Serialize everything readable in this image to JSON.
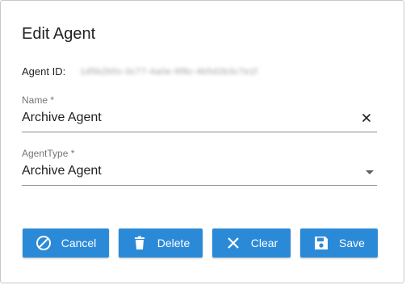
{
  "dialog": {
    "title": "Edit Agent",
    "agent_id_label": "Agent ID:",
    "agent_id_value": "1d5b2b5c-0c77-4a0e-9f8c-4b5d2b3c7e1f"
  },
  "fields": {
    "name": {
      "label": "Name *",
      "value": "Archive Agent"
    },
    "agent_type": {
      "label": "AgentType *",
      "value": "Archive Agent"
    }
  },
  "buttons": {
    "cancel": "Cancel",
    "delete": "Delete",
    "clear": "Clear",
    "save": "Save"
  },
  "icons": {
    "cancel": "block-icon",
    "delete": "trash-icon",
    "clear": "close-icon",
    "save": "floppy-disk-icon",
    "name_clear": "close-icon",
    "type_dropdown": "arrow-drop-down-icon"
  },
  "colors": {
    "primary": "#2b8ad8",
    "text": "#212121",
    "label": "#757575"
  }
}
